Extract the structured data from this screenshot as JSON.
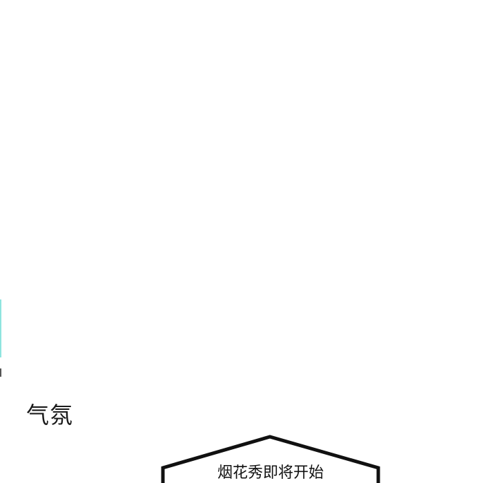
{
  "panel": {
    "background_color": "#ffffff",
    "side_mark_colors": [
      "#8fe4df",
      "#555555"
    ]
  },
  "sfx": {
    "text": "气氛"
  },
  "caption_box": {
    "text": "烟花秀即将开始",
    "border_color": "#111111"
  }
}
